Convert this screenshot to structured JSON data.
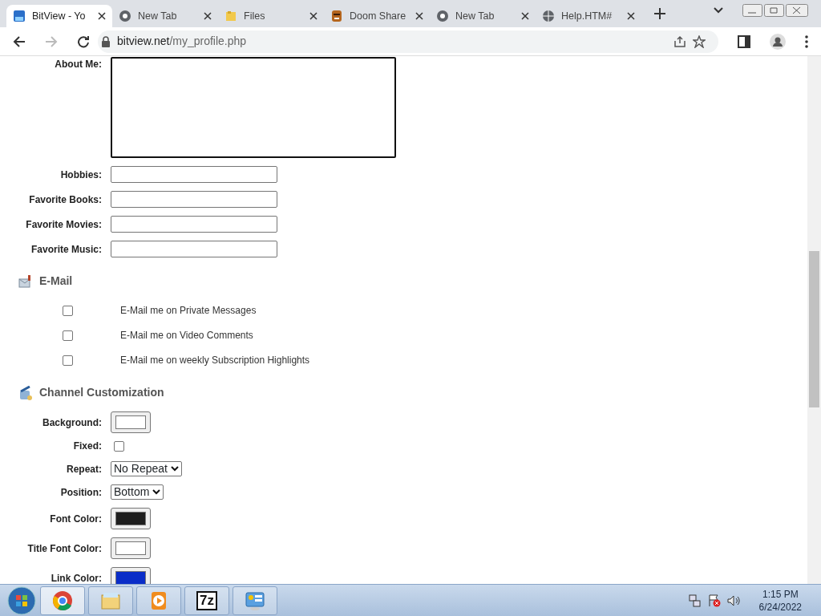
{
  "browser": {
    "tabs": [
      {
        "label": "BitView - Yo",
        "kind": "site",
        "selected": true
      },
      {
        "label": "New Tab",
        "kind": "chrome",
        "selected": false
      },
      {
        "label": "Files",
        "kind": "folder",
        "selected": false
      },
      {
        "label": "Doom Share",
        "kind": "face",
        "selected": false
      },
      {
        "label": "New Tab",
        "kind": "chrome",
        "selected": false
      },
      {
        "label": "Help.HTM#",
        "kind": "globe",
        "selected": false
      }
    ],
    "url_host": "bitview.net",
    "url_path": "/my_profile.php"
  },
  "profile_fields": [
    {
      "label": "About Me:",
      "kind": "textarea"
    },
    {
      "label": "Hobbies:",
      "kind": "text"
    },
    {
      "label": "Favorite Books:",
      "kind": "text"
    },
    {
      "label": "Favorite Movies:",
      "kind": "text"
    },
    {
      "label": "Favorite Music:",
      "kind": "text"
    }
  ],
  "email": {
    "title": "E-Mail",
    "options": [
      {
        "label": "E-Mail me on Private Messages",
        "checked": false
      },
      {
        "label": "E-Mail me on Video Comments",
        "checked": false
      },
      {
        "label": "E-Mail me on weekly Subscription Highlights",
        "checked": false
      }
    ]
  },
  "customization": {
    "title": "Channel Customization",
    "fields": [
      {
        "label": "Background:",
        "kind": "color",
        "color": "#ffffff"
      },
      {
        "label": "Fixed:",
        "kind": "checkbox",
        "checked": false
      },
      {
        "label": "Repeat:",
        "kind": "select",
        "value": "No Repeat"
      },
      {
        "label": "Position:",
        "kind": "select",
        "value": "Bottom"
      },
      {
        "label": "Font Color:",
        "kind": "color",
        "color": "#1e1e1e"
      },
      {
        "label": "Title Font Color:",
        "kind": "color",
        "color": "#ffffff"
      },
      {
        "label": "Link Color:",
        "kind": "color",
        "color": "#0a2dc8"
      }
    ]
  },
  "taskbar": {
    "items": [
      {
        "kind": "chrome",
        "selected": true
      },
      {
        "kind": "explorer",
        "selected": false
      },
      {
        "kind": "media",
        "selected": false
      },
      {
        "kind": "archiver",
        "label": "7z",
        "selected": false
      },
      {
        "kind": "control",
        "selected": false
      }
    ],
    "time": "1:15 PM",
    "date": "6/24/2022"
  }
}
